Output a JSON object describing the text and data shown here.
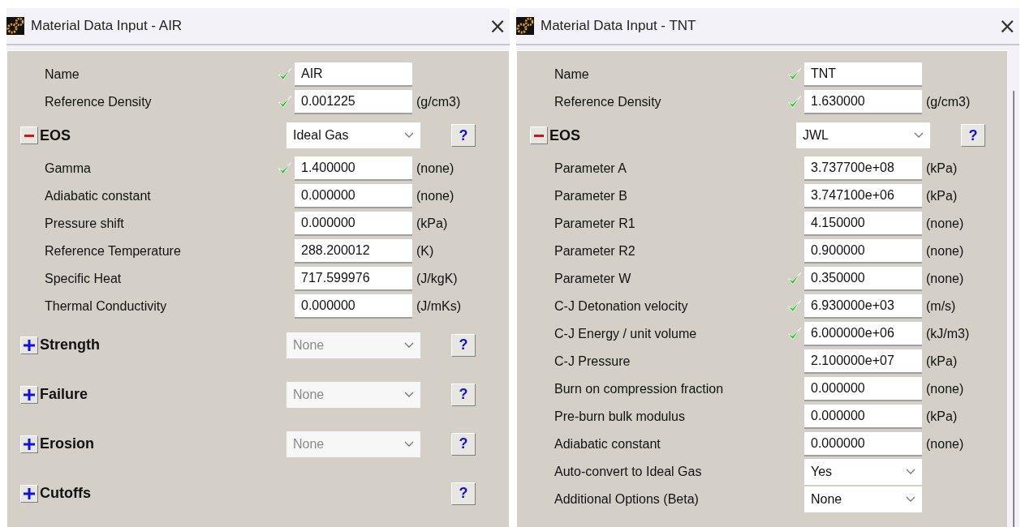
{
  "windows": [
    {
      "title": "Material Data Input - AIR",
      "close": "×",
      "scrollbar": false,
      "rows": [
        {
          "kind": "field",
          "label": "Name",
          "valid": true,
          "value": "AIR"
        },
        {
          "kind": "field",
          "label": "Reference Density",
          "valid": true,
          "value": "0.001225",
          "unit": "(g/cm3)"
        },
        {
          "kind": "section",
          "label": "EOS",
          "expanded": true,
          "select": {
            "value": "Ideal Gas",
            "disabled": false
          },
          "help": "?"
        },
        {
          "kind": "field",
          "label": "Gamma",
          "valid": true,
          "value": "1.400000",
          "unit": "(none)"
        },
        {
          "kind": "field",
          "label": "Adiabatic constant",
          "valid": false,
          "value": "0.000000",
          "unit": "(none)"
        },
        {
          "kind": "field",
          "label": "Pressure shift",
          "valid": false,
          "value": "0.000000",
          "unit": "(kPa)"
        },
        {
          "kind": "field",
          "label": "Reference Temperature",
          "valid": false,
          "value": "288.200012",
          "unit": "(K)"
        },
        {
          "kind": "field",
          "label": "Specific Heat",
          "valid": false,
          "value": "717.599976",
          "unit": "(J/kgK)"
        },
        {
          "kind": "field",
          "label": "Thermal Conductivity",
          "valid": false,
          "value": "0.000000",
          "unit": "(J/mKs)"
        },
        {
          "kind": "section",
          "label": "Strength",
          "expanded": false,
          "select": {
            "value": "None",
            "disabled": true
          },
          "help": "?"
        },
        {
          "kind": "section",
          "label": "Failure",
          "expanded": false,
          "select": {
            "value": "None",
            "disabled": true
          },
          "help": "?"
        },
        {
          "kind": "section",
          "label": "Erosion",
          "expanded": false,
          "select": {
            "value": "None",
            "disabled": true
          },
          "help": "?"
        },
        {
          "kind": "section",
          "label": "Cutoffs",
          "expanded": false,
          "help": "?"
        }
      ]
    },
    {
      "title": "Material Data Input - TNT",
      "close": "×",
      "scrollbar": true,
      "rows": [
        {
          "kind": "field",
          "label": "Name",
          "valid": true,
          "value": "TNT"
        },
        {
          "kind": "field",
          "label": "Reference Density",
          "valid": true,
          "value": "1.630000",
          "unit": "(g/cm3)"
        },
        {
          "kind": "section",
          "label": "EOS",
          "expanded": true,
          "select": {
            "value": "JWL",
            "disabled": false
          },
          "help": "?"
        },
        {
          "kind": "field",
          "label": "Parameter A",
          "valid": false,
          "value": "3.737700e+08",
          "unit": "(kPa)"
        },
        {
          "kind": "field",
          "label": "Parameter B",
          "valid": false,
          "value": "3.747100e+06",
          "unit": "(kPa)"
        },
        {
          "kind": "field",
          "label": "Parameter R1",
          "valid": false,
          "value": "4.150000",
          "unit": "(none)"
        },
        {
          "kind": "field",
          "label": "Parameter R2",
          "valid": false,
          "value": "0.900000",
          "unit": "(none)"
        },
        {
          "kind": "field",
          "label": "Parameter W",
          "valid": true,
          "value": "0.350000",
          "unit": "(none)"
        },
        {
          "kind": "field",
          "label": "C-J Detonation velocity",
          "valid": true,
          "value": "6.930000e+03",
          "unit": "(m/s)"
        },
        {
          "kind": "field",
          "label": "C-J Energy / unit volume",
          "valid": true,
          "value": "6.000000e+06",
          "unit": "(kJ/m3)"
        },
        {
          "kind": "field",
          "label": "C-J Pressure",
          "valid": false,
          "value": "2.100000e+07",
          "unit": "(kPa)"
        },
        {
          "kind": "field",
          "label": "Burn on compression fraction",
          "valid": false,
          "value": "0.000000",
          "unit": "(none)"
        },
        {
          "kind": "field",
          "label": "Pre-burn bulk modulus",
          "valid": false,
          "value": "0.000000",
          "unit": "(kPa)"
        },
        {
          "kind": "field",
          "label": "Adiabatic constant",
          "valid": false,
          "value": "0.000000",
          "unit": "(none)"
        },
        {
          "kind": "select",
          "label": "Auto-convert to Ideal Gas",
          "value": "Yes"
        },
        {
          "kind": "select",
          "label": "Additional Options (Beta)",
          "value": "None"
        }
      ]
    }
  ]
}
